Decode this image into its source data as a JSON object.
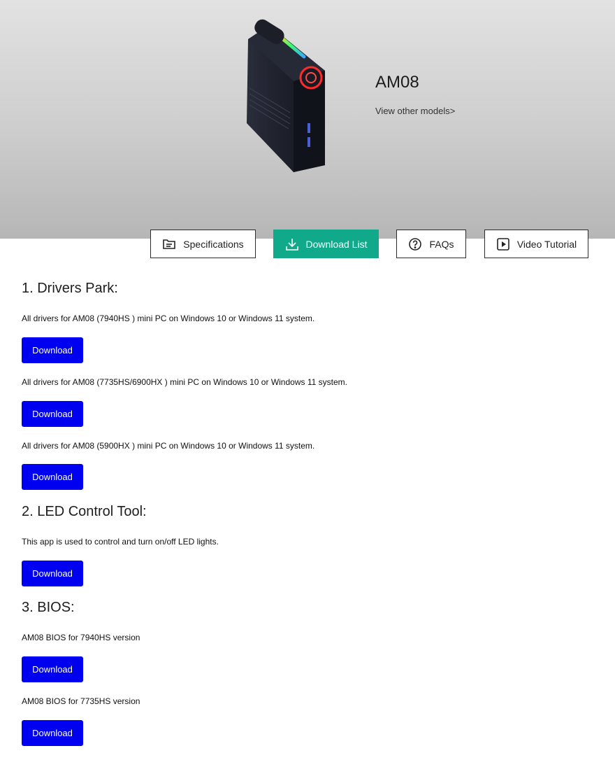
{
  "hero": {
    "model_name": "AM08",
    "view_other_models": "View other models>"
  },
  "tabs": [
    {
      "label": "Specifications",
      "icon": "document-folder-icon",
      "active": false
    },
    {
      "label": "Download List",
      "icon": "download-icon",
      "active": true
    },
    {
      "label": "FAQs",
      "icon": "question-circle-icon",
      "active": false
    },
    {
      "label": "Video Tutorial",
      "icon": "play-square-icon",
      "active": false
    }
  ],
  "colors": {
    "accent": "#10a98a",
    "download_button": "#0000f0"
  },
  "sections": [
    {
      "title": "1. Drivers Park:",
      "items": [
        {
          "description": "All drivers for AM08 (7940HS ) mini PC on Windows 10 or Windows 11 system.",
          "button": "Download"
        },
        {
          "description": "All drivers for AM08 (7735HS/6900HX ) mini PC on Windows 10 or Windows 11 system.",
          "button": "Download"
        },
        {
          "description": "All drivers for AM08 (5900HX ) mini PC on Windows 10 or Windows 11 system.",
          "button": "Download"
        }
      ]
    },
    {
      "title": "2. LED Control Tool:",
      "items": [
        {
          "description": "This app is used to control and turn on/off LED lights.",
          "button": "Download"
        }
      ]
    },
    {
      "title": "3. BIOS:",
      "items": [
        {
          "description": "AM08 BIOS for 7940HS version",
          "button": "Download"
        },
        {
          "description": "AM08 BIOS for 7735HS version",
          "button": "Download"
        }
      ]
    }
  ]
}
